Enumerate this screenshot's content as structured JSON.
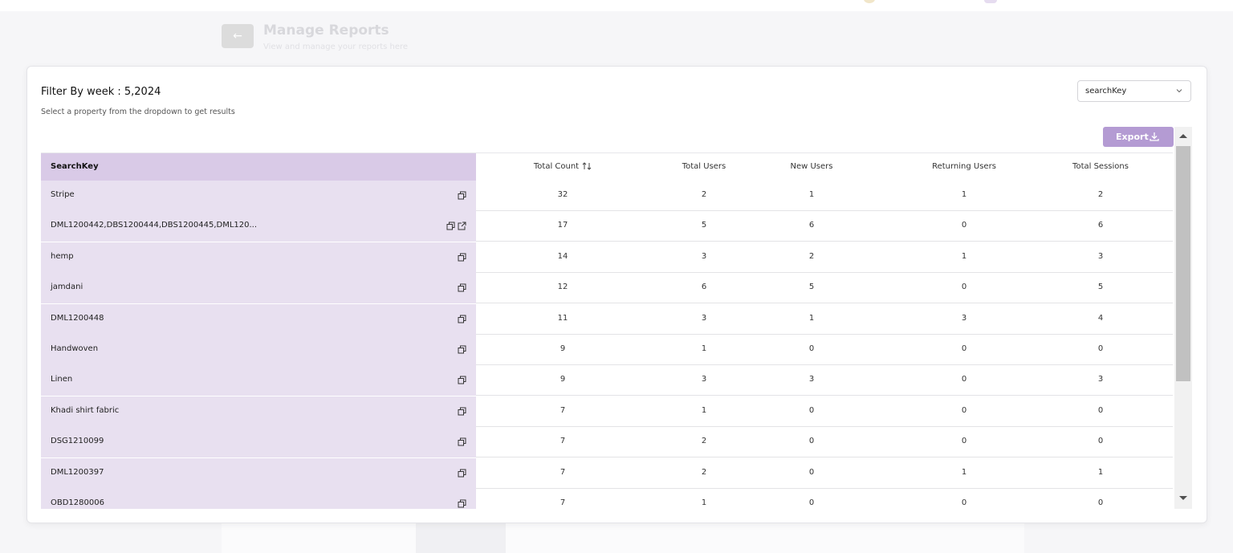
{
  "background": {
    "page_title": "Manage Reports",
    "page_subtitle": "View and manage your reports here"
  },
  "filter": {
    "title": "Filter By week : 5,2024",
    "subtitle": "Select a property from the dropdown to get results"
  },
  "property_select": {
    "value": "searchKey",
    "icon": "chevron-down-icon"
  },
  "export_button": {
    "label": "Export",
    "icon": "download-icon",
    "color": "#b49bd3"
  },
  "table": {
    "columns": [
      {
        "label": "SearchKey"
      },
      {
        "label": "Total Count",
        "icon": "sort-icon"
      },
      {
        "label": "Total Users"
      },
      {
        "label": "New Users"
      },
      {
        "label": "Returning Users"
      },
      {
        "label": "Total Sessions"
      }
    ],
    "rows": [
      {
        "key": "Stripe",
        "total_count": "32",
        "total_users": "2",
        "new_users": "1",
        "returning_users": "1",
        "total_sessions": "2"
      },
      {
        "key": "DML1200442,DBS1200444,DBS1200445,DML120...",
        "total_count": "17",
        "total_users": "5",
        "new_users": "6",
        "returning_users": "0",
        "total_sessions": "6",
        "has_external_link": true
      },
      {
        "key": "hemp",
        "total_count": "14",
        "total_users": "3",
        "new_users": "2",
        "returning_users": "1",
        "total_sessions": "3"
      },
      {
        "key": "jamdani",
        "total_count": "12",
        "total_users": "6",
        "new_users": "5",
        "returning_users": "0",
        "total_sessions": "5"
      },
      {
        "key": "DML1200448",
        "total_count": "11",
        "total_users": "3",
        "new_users": "1",
        "returning_users": "3",
        "total_sessions": "4"
      },
      {
        "key": "Handwoven",
        "total_count": "9",
        "total_users": "1",
        "new_users": "0",
        "returning_users": "0",
        "total_sessions": "0"
      },
      {
        "key": "Linen",
        "total_count": "9",
        "total_users": "3",
        "new_users": "3",
        "returning_users": "0",
        "total_sessions": "3"
      },
      {
        "key": "Khadi shirt fabric",
        "total_count": "7",
        "total_users": "1",
        "new_users": "0",
        "returning_users": "0",
        "total_sessions": "0"
      },
      {
        "key": "DSG1210099",
        "total_count": "7",
        "total_users": "2",
        "new_users": "0",
        "returning_users": "0",
        "total_sessions": "0"
      },
      {
        "key": "DML1200397",
        "total_count": "7",
        "total_users": "2",
        "new_users": "0",
        "returning_users": "1",
        "total_sessions": "1"
      },
      {
        "key": "OBD1280006",
        "total_count": "7",
        "total_users": "1",
        "new_users": "0",
        "returning_users": "0",
        "total_sessions": "0"
      }
    ]
  },
  "colors": {
    "key_column_header": "#d9cae7",
    "key_column_cells": "#e8e0f0"
  }
}
